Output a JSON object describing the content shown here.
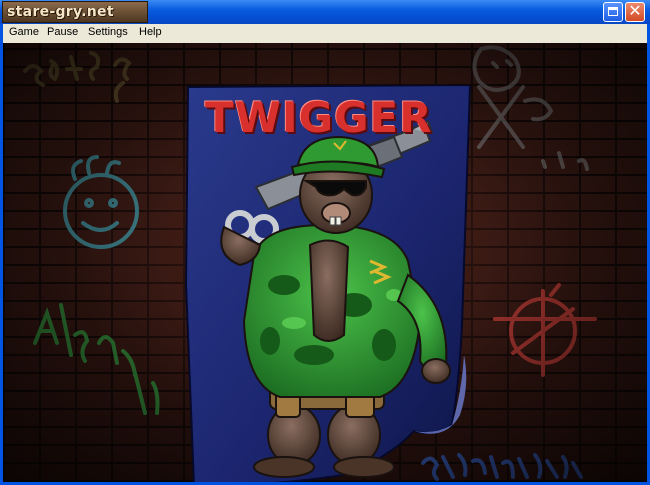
{
  "window": {
    "title_logo": "stare-gry.net"
  },
  "menu": {
    "items": [
      "Game",
      "Pause",
      "Settings",
      "Help"
    ]
  },
  "poster": {
    "title": "TWIGGER"
  },
  "colors": {
    "titlebar": "#0653d8",
    "menubar": "#ece9d8",
    "poster_blue": "#1f2d7a",
    "title_red": "#d8302c",
    "camo_green": "#2f9a32"
  }
}
